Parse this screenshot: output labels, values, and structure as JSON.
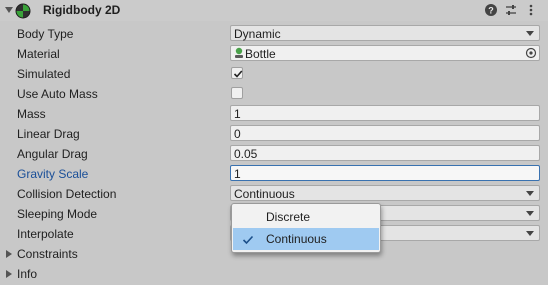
{
  "header": {
    "title": "Rigidbody 2D",
    "icons": [
      "foldout-arrow",
      "rigidbody2d-icon",
      "help-icon",
      "presets-icon",
      "more-options-icon"
    ]
  },
  "properties": {
    "body_type": {
      "label": "Body Type",
      "value": "Dynamic"
    },
    "material": {
      "label": "Material",
      "value": "Bottle"
    },
    "simulated": {
      "label": "Simulated",
      "checked": true
    },
    "use_auto_mass": {
      "label": "Use Auto Mass",
      "checked": false
    },
    "mass": {
      "label": "Mass",
      "value": "1"
    },
    "linear_drag": {
      "label": "Linear Drag",
      "value": "0"
    },
    "angular_drag": {
      "label": "Angular Drag",
      "value": "0.05"
    },
    "gravity_scale": {
      "label": "Gravity Scale",
      "value": "1"
    },
    "collision_detection": {
      "label": "Collision Detection",
      "value": "Continuous"
    },
    "sleeping_mode": {
      "label": "Sleeping Mode",
      "value": ""
    },
    "interpolate": {
      "label": "Interpolate",
      "value": ""
    }
  },
  "sections": {
    "constraints": "Constraints",
    "info": "Info"
  },
  "dropdown": {
    "options": [
      {
        "label": "Discrete",
        "selected": false
      },
      {
        "label": "Continuous",
        "selected": true
      }
    ]
  },
  "colors": {
    "background": "#c8c8c8",
    "label_highlight": "#1a4f98",
    "menu_selected": "#9fcaf1",
    "field_focus": "#3a72b0"
  }
}
